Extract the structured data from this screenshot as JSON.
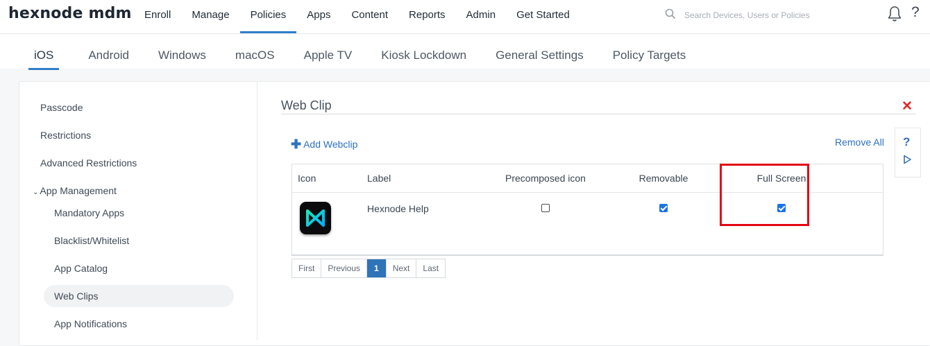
{
  "app": {
    "logo": "hexnode mdm"
  },
  "nav": {
    "items": [
      "Enroll",
      "Manage",
      "Policies",
      "Apps",
      "Content",
      "Reports",
      "Admin",
      "Get Started"
    ],
    "active": "Policies"
  },
  "search": {
    "placeholder": "Search Devices, Users or Policies"
  },
  "icons": {
    "search": "search-icon",
    "bell": "bell-icon",
    "help": "help-icon",
    "close": "close-icon",
    "add": "plus-icon",
    "play": "play-icon"
  },
  "help_label": "?",
  "subnav": {
    "tabs": [
      "iOS",
      "Android",
      "Windows",
      "macOS",
      "Apple TV",
      "Kiosk Lockdown",
      "General Settings",
      "Policy Targets"
    ],
    "active": "iOS"
  },
  "sidebar": {
    "items": [
      "Passcode",
      "Restrictions",
      "Advanced Restrictions"
    ],
    "group": {
      "label": "App Management",
      "chevron": "⌄",
      "children": [
        "Mandatory Apps",
        "Blacklist/Whitelist",
        "App Catalog",
        "Web Clips",
        "App Notifications"
      ],
      "selected": "Web Clips"
    }
  },
  "content": {
    "title": "Web Clip",
    "close_glyph": "✕",
    "add_label": "Add Webclip",
    "remove_all_label": "Remove All",
    "table": {
      "headers": [
        "Icon",
        "Label",
        "Precomposed icon",
        "Removable",
        "Full Screen"
      ],
      "rows": [
        {
          "icon": "hexnode-help-app-icon",
          "label": "Hexnode Help",
          "precomposed": false,
          "removable": true,
          "full_screen": true
        }
      ]
    },
    "pager": {
      "first": "First",
      "previous": "Previous",
      "current": "1",
      "next": "Next",
      "last": "Last"
    }
  },
  "colors": {
    "accent": "#2f7fc8",
    "link": "#2d72bd",
    "close": "#e02525",
    "highlight": "#e30613",
    "checkbox": "#1a73e8"
  }
}
